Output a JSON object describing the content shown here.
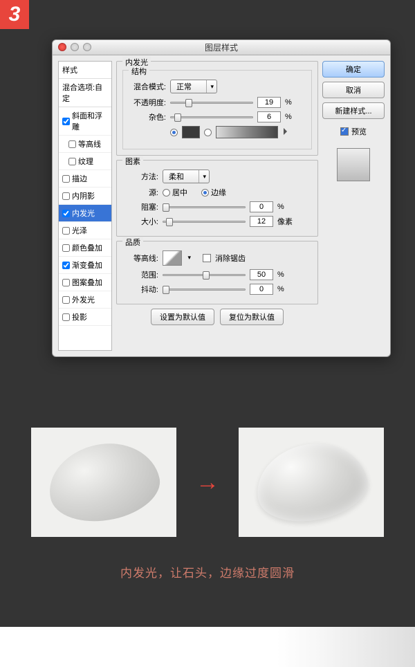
{
  "step": "3",
  "dialog": {
    "title": "图层样式",
    "styles_list": {
      "header": "样式",
      "blend_header": "混合选项:自定",
      "items": [
        {
          "label": "斜面和浮雕",
          "checked": true,
          "indent": false
        },
        {
          "label": "等高线",
          "checked": false,
          "indent": true
        },
        {
          "label": "纹理",
          "checked": false,
          "indent": true
        },
        {
          "label": "描边",
          "checked": false,
          "indent": false
        },
        {
          "label": "内阴影",
          "checked": false,
          "indent": false
        },
        {
          "label": "内发光",
          "checked": true,
          "indent": false,
          "selected": true
        },
        {
          "label": "光泽",
          "checked": false,
          "indent": false
        },
        {
          "label": "颜色叠加",
          "checked": false,
          "indent": false
        },
        {
          "label": "渐变叠加",
          "checked": true,
          "indent": false
        },
        {
          "label": "图案叠加",
          "checked": false,
          "indent": false
        },
        {
          "label": "外发光",
          "checked": false,
          "indent": false
        },
        {
          "label": "投影",
          "checked": false,
          "indent": false
        }
      ]
    },
    "inner_glow": {
      "title": "内发光",
      "structure": {
        "title": "结构",
        "blend_mode_label": "混合模式:",
        "blend_mode_value": "正常",
        "opacity_label": "不透明度:",
        "opacity_value": "19",
        "opacity_unit": "%",
        "noise_label": "杂色:",
        "noise_value": "6",
        "noise_unit": "%"
      },
      "elements": {
        "title": "图素",
        "technique_label": "方法:",
        "technique_value": "柔和",
        "source_label": "源:",
        "source_center": "居中",
        "source_edge": "边缘",
        "choke_label": "阻塞:",
        "choke_value": "0",
        "choke_unit": "%",
        "size_label": "大小:",
        "size_value": "12",
        "size_unit": "像素"
      },
      "quality": {
        "title": "品质",
        "contour_label": "等高线:",
        "antialias_label": "消除锯齿",
        "range_label": "范围:",
        "range_value": "50",
        "range_unit": "%",
        "jitter_label": "抖动:",
        "jitter_value": "0",
        "jitter_unit": "%"
      },
      "set_default": "设置为默认值",
      "reset_default": "复位为默认值"
    },
    "buttons": {
      "ok": "确定",
      "cancel": "取消",
      "new_style": "新建样式...",
      "preview": "预览"
    }
  },
  "arrow": "→",
  "caption": "内发光，让石头，边缘过度圆滑"
}
